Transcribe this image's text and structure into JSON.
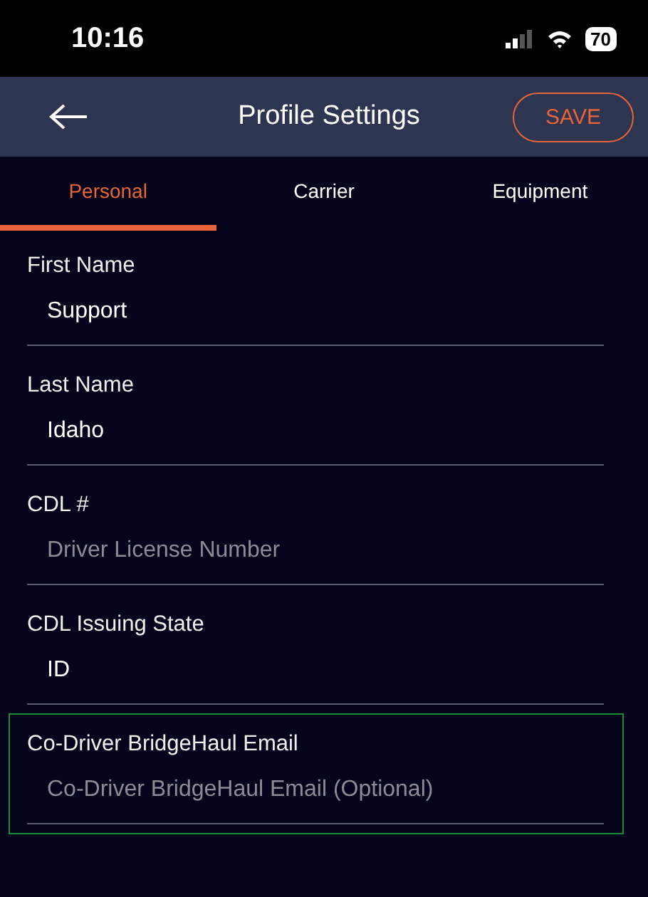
{
  "status_bar": {
    "time": "10:16",
    "battery": "70"
  },
  "header": {
    "title": "Profile Settings",
    "save_button": "SAVE"
  },
  "tabs": [
    {
      "label": "Personal",
      "selected": true
    },
    {
      "label": "Carrier",
      "selected": false
    },
    {
      "label": "Equipment",
      "selected": false
    }
  ],
  "fields": [
    {
      "label": "First Name",
      "value": "Support",
      "highlighted": false
    },
    {
      "label": "Last Name",
      "value": "Idaho",
      "highlighted": false
    },
    {
      "label": "CDL #",
      "placeholder": "Driver License Number",
      "highlighted": false
    },
    {
      "label": "CDL Issuing State",
      "value": "ID",
      "highlighted": false
    },
    {
      "label": "Co-Driver BridgeHaul Email",
      "placeholder": "Co-Driver BridgeHaul Email (Optional)",
      "highlighted": true
    }
  ]
}
